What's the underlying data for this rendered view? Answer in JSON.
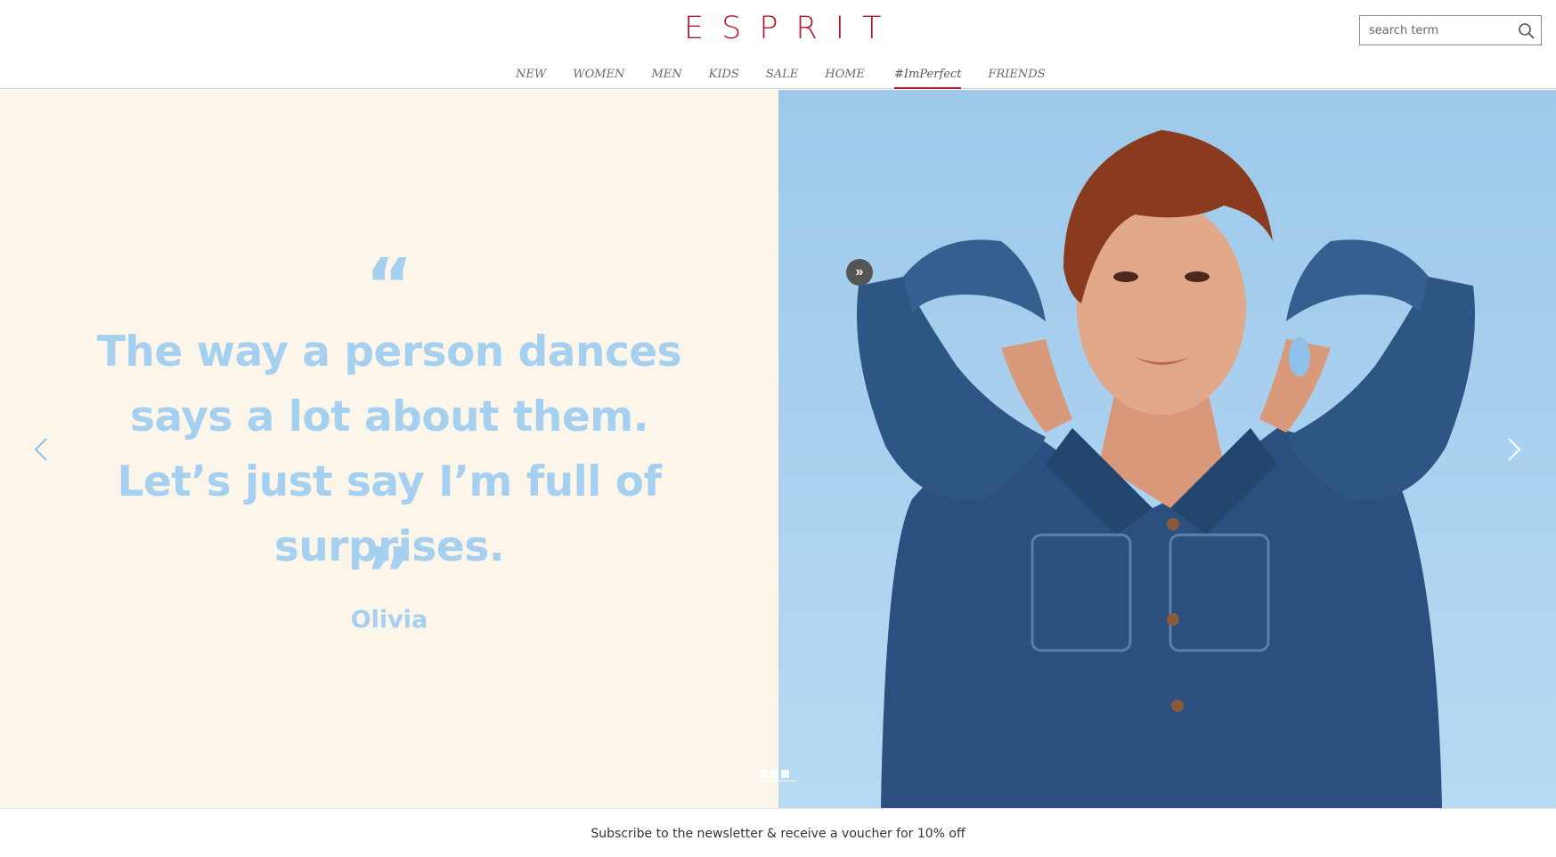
{
  "brand": {
    "logo_text": "ESPRIT",
    "accent_color": "#b5172a"
  },
  "search": {
    "placeholder": "search term",
    "icon": "search-icon"
  },
  "nav": {
    "items": [
      {
        "label": "NEW"
      },
      {
        "label": "WOMEN"
      },
      {
        "label": "MEN"
      },
      {
        "label": "KIDS"
      },
      {
        "label": "SALE"
      },
      {
        "label": "HOME"
      },
      {
        "label": "#ImPerfect",
        "active": true
      },
      {
        "label": "FRIENDS"
      }
    ]
  },
  "hero": {
    "quote_open": "“",
    "quote_close": "”",
    "quote": "The way a person dances says a lot about them. Let’s just say I’m full of surprises.",
    "author": "Olivia",
    "quote_color": "#a6d0ef",
    "background_left": "#fbf5ea",
    "play_label": "»",
    "slides": [
      {
        "active": false
      },
      {
        "active": true
      },
      {
        "active": false
      }
    ],
    "prev_icon": "chevron-left-icon",
    "next_icon": "chevron-right-icon"
  },
  "footer": {
    "newsletter_text": "Subscribe to the newsletter & receive a voucher for 10% off"
  }
}
